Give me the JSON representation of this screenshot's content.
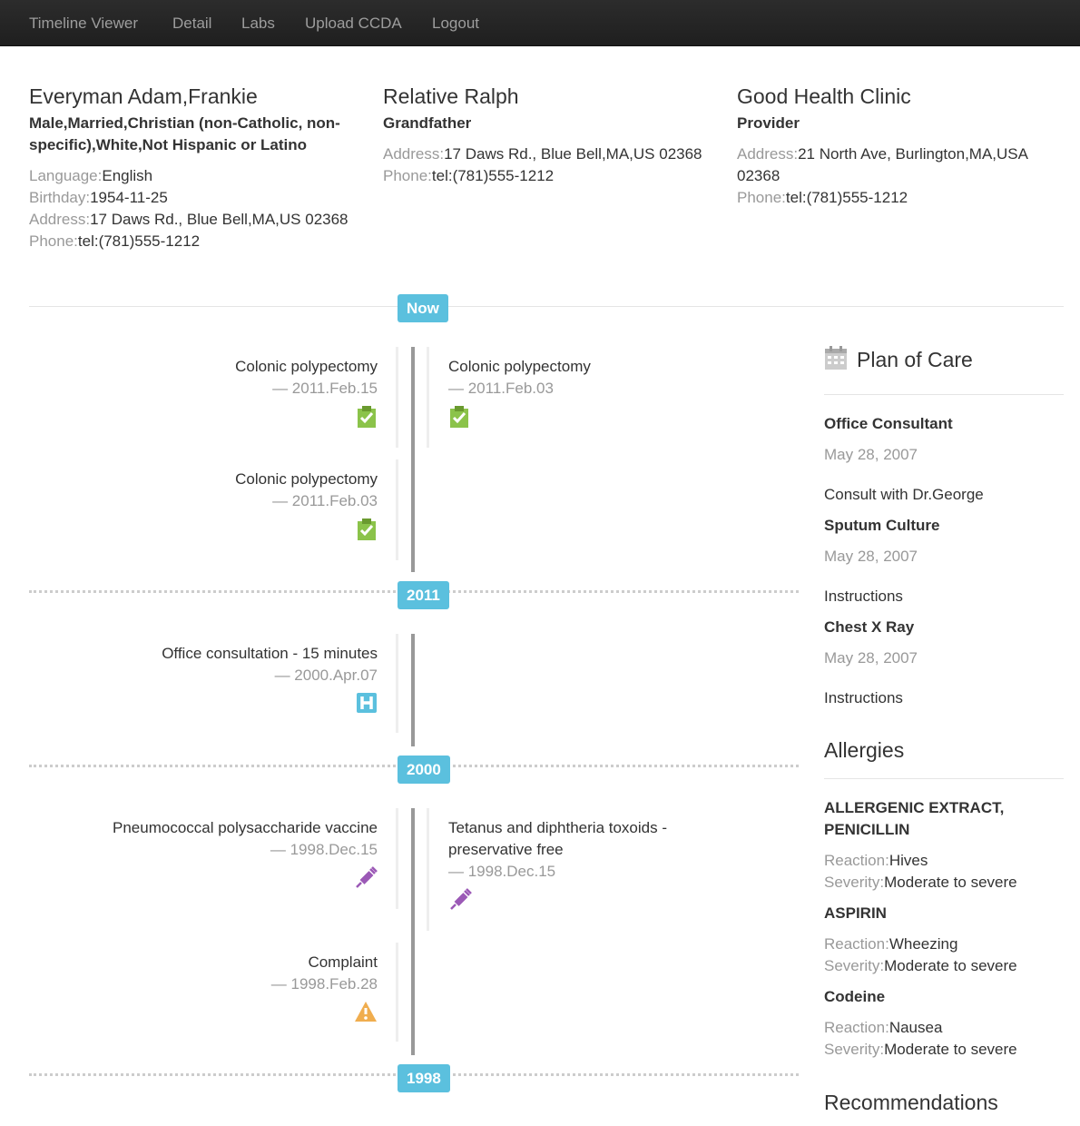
{
  "nav": [
    "Timeline Viewer",
    "Detail",
    "Labs",
    "Upload CCDA",
    "Logout"
  ],
  "patient": {
    "name": "Everyman Adam,Frankie",
    "demographics": "Male,Married,Christian (non-Catholic, non-specific),White,Not Hispanic or Latino",
    "language_label": "Language:",
    "language": "English",
    "birthday_label": "Birthday:",
    "birthday": "1954-11-25",
    "address_label": "Address:",
    "address": "17 Daws Rd., Blue Bell,MA,US 02368",
    "phone_label": "Phone:",
    "phone": "tel:(781)555-1212"
  },
  "relative": {
    "name": "Relative Ralph",
    "relation": "Grandfather",
    "address_label": "Address:",
    "address": "17 Daws Rd., Blue Bell,MA,US 02368",
    "phone_label": "Phone:",
    "phone": "tel:(781)555-1212"
  },
  "provider": {
    "name": "Good Health Clinic",
    "role": "Provider",
    "address_label": "Address:",
    "address": "21 North Ave, Burlington,MA,USA 02368",
    "phone_label": "Phone:",
    "phone": "tel:(781)555-1212"
  },
  "timeline": {
    "badges": [
      "Now",
      "2011",
      "2000",
      "1998"
    ],
    "events": [
      {
        "title": "Colonic polypectomy",
        "date": "— 2011.Feb.15",
        "icon": "clipboard-check-icon"
      },
      {
        "title": "Colonic polypectomy",
        "date": "— 2011.Feb.03",
        "icon": "clipboard-check-icon"
      },
      {
        "title": "Colonic polypectomy",
        "date": "— 2011.Feb.03",
        "icon": "clipboard-check-icon"
      },
      {
        "title": "Office consultation - 15 minutes",
        "date": "— 2000.Apr.07",
        "icon": "hospital-icon"
      },
      {
        "title": "Pneumococcal polysaccharide vaccine",
        "date": "— 1998.Dec.15",
        "icon": "syringe-icon"
      },
      {
        "title": "Tetanus and diphtheria toxoids - preservative free",
        "date": "— 1998.Dec.15",
        "icon": "syringe-icon"
      },
      {
        "title": "Complaint",
        "date": "— 1998.Feb.28",
        "icon": "warning-icon"
      }
    ]
  },
  "plan_of_care": {
    "title": "Plan of Care",
    "icon": "calendar-icon",
    "items": [
      {
        "name": "Office Consultant",
        "date": "May 28, 2007",
        "note": "Consult with Dr.George"
      },
      {
        "name": "Sputum Culture",
        "date": "May 28, 2007",
        "note": "Instructions"
      },
      {
        "name": "Chest X Ray",
        "date": "May 28, 2007",
        "note": "Instructions"
      }
    ]
  },
  "allergies": {
    "title": "Allergies",
    "reaction_label": "Reaction:",
    "severity_label": "Severity:",
    "items": [
      {
        "name": "ALLERGENIC EXTRACT, PENICILLIN",
        "reaction": "Hives",
        "severity": "Moderate to severe"
      },
      {
        "name": "ASPIRIN",
        "reaction": "Wheezing",
        "severity": "Moderate to severe"
      },
      {
        "name": "Codeine",
        "reaction": "Nausea",
        "severity": "Moderate to severe"
      }
    ]
  },
  "recommendations": {
    "title": "Recommendations"
  },
  "colors": {
    "badge": "#5bc0de",
    "procedure_icon": "#8bc34a",
    "encounter_icon": "#5bc0de",
    "immunization_icon": "#9b59b6",
    "warning_icon": "#f0ad4e"
  }
}
